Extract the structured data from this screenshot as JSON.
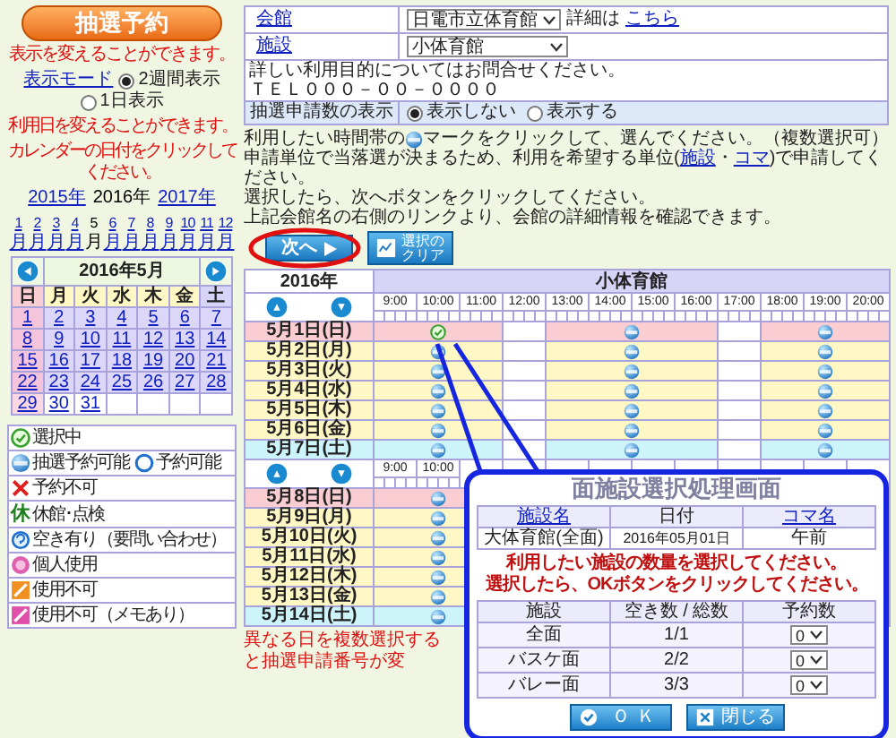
{
  "left": {
    "title": "抽選予約",
    "display_note": "表示を変えることができます。",
    "mode_link": "表示モード",
    "modes": [
      {
        "label": "2週間表示",
        "selected": true
      },
      {
        "label": "1日表示",
        "selected": false
      }
    ],
    "date_note": [
      "利用日を変えることができます。",
      "カレンダーの日付をクリックしてください。"
    ],
    "years": [
      {
        "label": "2015年",
        "selected": false
      },
      {
        "label": "2016年",
        "selected": true
      },
      {
        "label": "2017年",
        "selected": false
      }
    ],
    "months": [
      {
        "number": "1",
        "unit": "月",
        "selected": false
      },
      {
        "number": "2",
        "unit": "月",
        "selected": false
      },
      {
        "number": "3",
        "unit": "月",
        "selected": false
      },
      {
        "number": "4",
        "unit": "月",
        "selected": false
      },
      {
        "number": "5",
        "unit": "月",
        "selected": true
      },
      {
        "number": "6",
        "unit": "月",
        "selected": false
      },
      {
        "number": "7",
        "unit": "月",
        "selected": false
      },
      {
        "number": "8",
        "unit": "月",
        "selected": false
      },
      {
        "number": "9",
        "unit": "月",
        "selected": false
      },
      {
        "number": "10",
        "unit": "月",
        "selected": false
      },
      {
        "number": "11",
        "unit": "月",
        "selected": false
      },
      {
        "number": "12",
        "unit": "月",
        "selected": false
      }
    ],
    "calendar": {
      "title": "2016年5月",
      "weekdays": [
        "日",
        "月",
        "火",
        "水",
        "木",
        "金",
        "土"
      ],
      "weeks": [
        [
          {
            "day": "1",
            "highlighted": true
          },
          {
            "day": "2",
            "highlighted": true
          },
          {
            "day": "3",
            "highlighted": true
          },
          {
            "day": "4",
            "highlighted": true
          },
          {
            "day": "5",
            "highlighted": true
          },
          {
            "day": "6",
            "highlighted": true
          },
          {
            "day": "7",
            "highlighted": true
          }
        ],
        [
          {
            "day": "8",
            "highlighted": true
          },
          {
            "day": "9",
            "highlighted": true
          },
          {
            "day": "10",
            "highlighted": true
          },
          {
            "day": "11",
            "highlighted": true
          },
          {
            "day": "12",
            "highlighted": true
          },
          {
            "day": "13",
            "highlighted": true
          },
          {
            "day": "14",
            "highlighted": true
          }
        ],
        [
          {
            "day": "15",
            "highlighted": true
          },
          {
            "day": "16",
            "highlighted": true
          },
          {
            "day": "17",
            "highlighted": true
          },
          {
            "day": "18",
            "highlighted": true
          },
          {
            "day": "19",
            "highlighted": true
          },
          {
            "day": "20",
            "highlighted": true
          },
          {
            "day": "21",
            "highlighted": true
          }
        ],
        [
          {
            "day": "22",
            "highlighted": true
          },
          {
            "day": "23",
            "highlighted": true
          },
          {
            "day": "24",
            "highlighted": true
          },
          {
            "day": "25",
            "highlighted": true
          },
          {
            "day": "26",
            "highlighted": true
          },
          {
            "day": "27",
            "highlighted": true
          },
          {
            "day": "28",
            "highlighted": true
          }
        ],
        [
          {
            "day": "29",
            "highlighted": false
          },
          {
            "day": "30",
            "highlighted": false
          },
          {
            "day": "31",
            "highlighted": false
          }
        ]
      ]
    },
    "legend": [
      [
        {
          "kind": "selected",
          "label": "選択中"
        }
      ],
      [
        {
          "kind": "lottery",
          "label": "抽選予約可能"
        },
        {
          "kind": "available",
          "label": "予約可能"
        }
      ],
      [
        {
          "kind": "unavailable",
          "label": "予約不可"
        }
      ],
      [
        {
          "kind": "closed",
          "glyph": "休",
          "label": "休館･点検"
        }
      ],
      [
        {
          "kind": "inquire",
          "label": "空き有り（要問い合わせ）"
        }
      ],
      [
        {
          "kind": "personal",
          "label": "個人使用"
        }
      ],
      [
        {
          "kind": "disabled",
          "label": "使用不可"
        }
      ],
      [
        {
          "kind": "memo",
          "label": "使用不可（メモあり）"
        }
      ]
    ]
  },
  "venue": {
    "label": "会館",
    "value": "日電市立体育館",
    "detail_prefix": "詳細は",
    "detail_link": "こちら"
  },
  "facility": {
    "label": "施設",
    "value": "小体育館"
  },
  "notes": [
    "詳しい利用目的についてはお問合せください。",
    "ＴＥＬ０００－００－００００"
  ],
  "count_display": {
    "label": "抽選申請数の表示",
    "options": [
      {
        "label": "表示しない",
        "selected": true
      },
      {
        "label": "表示する",
        "selected": false
      }
    ]
  },
  "instructions": [
    {
      "kind": "icon",
      "before": "利用したい時間帯の",
      "after": "マークをクリックして、選んでください。（複数選択可）"
    },
    {
      "kind": "links",
      "before": "申請単位で当落選が決まるため、利用を希望する単位(",
      "link1": "施設",
      "sep": "・",
      "link2": "コマ",
      "after": ")で申請してください。"
    },
    {
      "kind": "plain",
      "text": "選択したら、次へボタンをクリックしてください。"
    },
    {
      "kind": "plain",
      "text": "上記会館名の右側のリンクより、会館の詳細情報を確認できます。"
    }
  ],
  "next_button": "次へ",
  "clear_button": [
    "選択の",
    "クリア"
  ],
  "schedule": {
    "year": "2016年",
    "facility": "小体育館",
    "weeks": [
      {
        "hours": [
          "9:00",
          "10:00",
          "11:00",
          "12:00",
          "13:00",
          "14:00",
          "15:00",
          "16:00",
          "17:00",
          "18:00",
          "19:00",
          "20:00"
        ],
        "days": [
          {
            "date": "5月1日(日)",
            "kind": "sunday",
            "slots": [
              {
                "kind": "selected"
              },
              {
                "kind": "lottery"
              },
              {
                "kind": "lottery"
              }
            ]
          },
          {
            "date": "5月2日(月)",
            "kind": "weekday",
            "slots": [
              {
                "kind": "lottery"
              },
              {
                "kind": "lottery"
              },
              {
                "kind": "lottery"
              }
            ]
          },
          {
            "date": "5月3日(火)",
            "kind": "weekday",
            "slots": [
              {
                "kind": "lottery"
              },
              {
                "kind": "lottery"
              },
              {
                "kind": "lottery"
              }
            ]
          },
          {
            "date": "5月4日(水)",
            "kind": "weekday",
            "slots": [
              {
                "kind": "lottery"
              },
              {
                "kind": "lottery"
              },
              {
                "kind": "lottery"
              }
            ]
          },
          {
            "date": "5月5日(木)",
            "kind": "weekday",
            "slots": [
              {
                "kind": "lottery"
              },
              {
                "kind": "lottery"
              },
              {
                "kind": "lottery"
              }
            ]
          },
          {
            "date": "5月6日(金)",
            "kind": "weekday",
            "slots": [
              {
                "kind": "lottery"
              },
              {
                "kind": "lottery"
              },
              {
                "kind": "lottery"
              }
            ]
          },
          {
            "date": "5月7日(土)",
            "kind": "saturday",
            "slots": [
              {
                "kind": "lottery"
              },
              {
                "kind": "lottery"
              },
              {
                "kind": "lottery"
              }
            ]
          }
        ]
      },
      {
        "hours": [
          "9:00",
          "10:00"
        ],
        "days": [
          {
            "date": "5月8日(日)",
            "kind": "sunday",
            "slots": [
              {
                "kind": "lottery"
              }
            ]
          },
          {
            "date": "5月9日(月)",
            "kind": "weekday",
            "slots": [
              {
                "kind": "lottery"
              }
            ]
          },
          {
            "date": "5月10日(火)",
            "kind": "weekday",
            "slots": [
              {
                "kind": "lottery"
              }
            ]
          },
          {
            "date": "5月11日(水)",
            "kind": "weekday",
            "slots": [
              {
                "kind": "lottery"
              }
            ]
          },
          {
            "date": "5月12日(木)",
            "kind": "weekday",
            "slots": [
              {
                "kind": "lottery"
              }
            ]
          },
          {
            "date": "5月13日(金)",
            "kind": "weekday",
            "slots": [
              {
                "kind": "lottery"
              }
            ]
          },
          {
            "date": "5月14日(土)",
            "kind": "saturday",
            "slots": [
              {
                "kind": "lottery"
              }
            ]
          }
        ]
      }
    ]
  },
  "footer_note": "異なる日を複数選択すると抽選申請番号が変",
  "dialog": {
    "title": "面施設選択処理画面",
    "info": {
      "columns": [
        {
          "label": "施設名",
          "link": true
        },
        {
          "label": "日付",
          "link": false
        },
        {
          "label": "コマ名",
          "link": true
        }
      ],
      "row": [
        "大体育館(全面)",
        "2016年05月01日",
        "午前"
      ]
    },
    "messages": [
      "利用したい施設の数量を選択してください。",
      "選択したら、OKボタンをクリックしてください。"
    ],
    "quantity": {
      "columns": [
        "施設",
        "空き数 / 総数",
        "予約数"
      ],
      "rows": [
        {
          "name": "全面",
          "availability": "1/1",
          "count": "0"
        },
        {
          "name": "バスケ面",
          "availability": "2/2",
          "count": "0"
        },
        {
          "name": "バレー面",
          "availability": "3/3",
          "count": "0"
        }
      ]
    },
    "ok_button": "ＯＫ",
    "close_button": "閉じる"
  }
}
